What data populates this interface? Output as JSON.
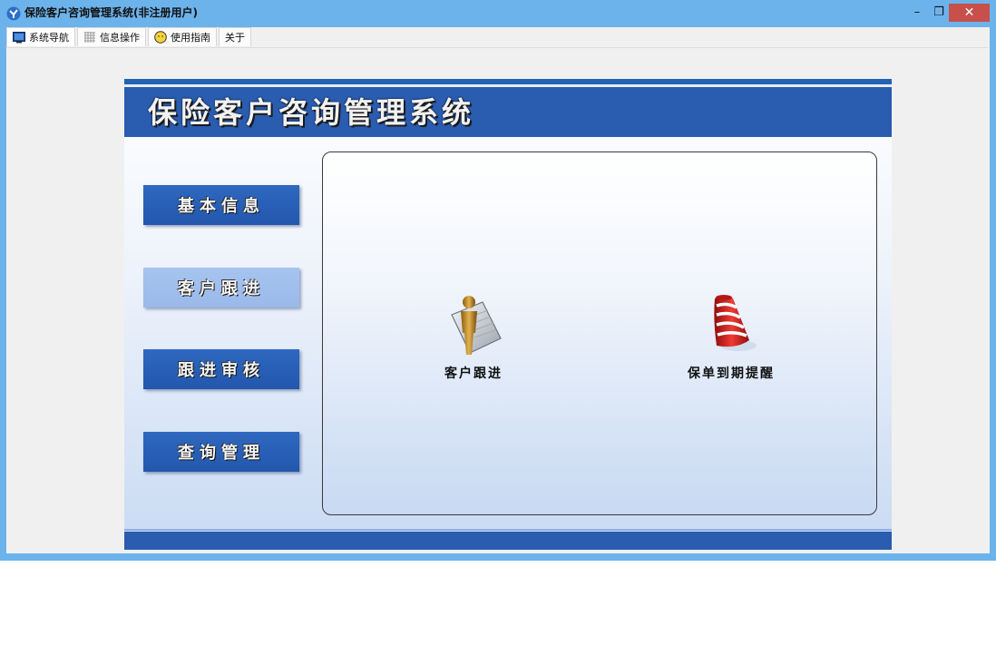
{
  "window": {
    "title": "保险客户咨询管理系统(非注册用户)",
    "minimize_glyph": "–",
    "restore_glyph": "❐",
    "close_glyph": "✕"
  },
  "tabs": [
    {
      "label": "系统导航",
      "icon": "monitor-icon"
    },
    {
      "label": "信息操作",
      "icon": "grid-icon"
    },
    {
      "label": "使用指南",
      "icon": "smiley-icon"
    },
    {
      "label": "关于",
      "icon": ""
    }
  ],
  "banner": {
    "title": "保险客户咨询管理系统"
  },
  "nav": [
    {
      "label": "基本信息",
      "selected": false
    },
    {
      "label": "客户跟进",
      "selected": true
    },
    {
      "label": "跟进审核",
      "selected": false
    },
    {
      "label": "查询管理",
      "selected": false
    }
  ],
  "features": [
    {
      "label": "客户跟进",
      "icon": "user-document-icon"
    },
    {
      "label": "保单到期提醒",
      "icon": "alarm-bell-icon"
    }
  ],
  "colors": {
    "titlebar": "#6cb3ec",
    "banner": "#2a5cb0",
    "nav_button": "#2a5cb0",
    "nav_button_selected": "#a6c4ef",
    "close_button": "#c7504a"
  }
}
